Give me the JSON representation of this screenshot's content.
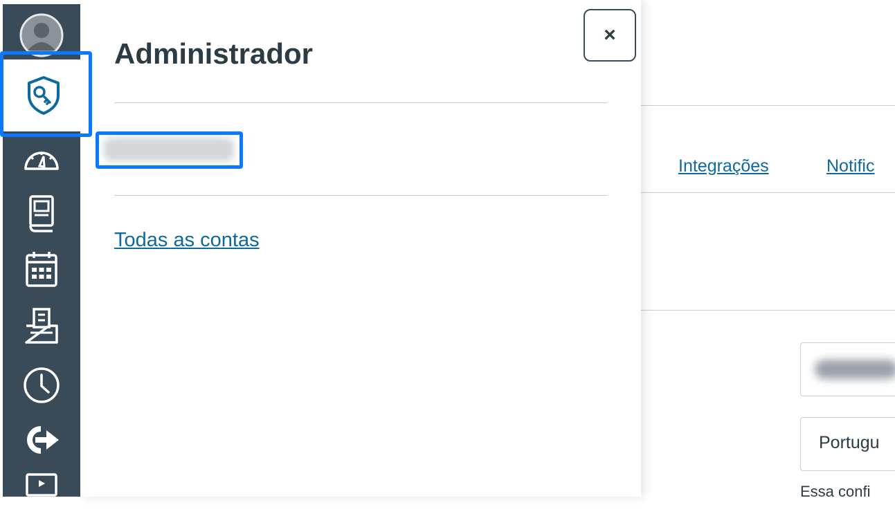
{
  "tray": {
    "title": "Administrador",
    "close_label": "×",
    "account_name_redacted": "",
    "all_accounts_link": "Todas as contas"
  },
  "background_page": {
    "tabs": [
      "Integrações",
      "Notific"
    ],
    "language_value": "Portugu",
    "note": "Essa confi"
  },
  "rail": {
    "items": [
      "account-icon",
      "admin-shield-key-icon",
      "dashboard-gauge-icon",
      "courses-book-icon",
      "calendar-icon",
      "inbox-tray-icon",
      "history-clock-icon",
      "commons-arrow-icon",
      "studio-video-icon"
    ],
    "active_item": "admin-shield-key-icon"
  },
  "colors": {
    "rail_bg": "#394b58",
    "focus_ring": "#0b79ff",
    "link": "#0e6a9e",
    "text": "#2d3b45",
    "divider": "#c7cdd1"
  }
}
